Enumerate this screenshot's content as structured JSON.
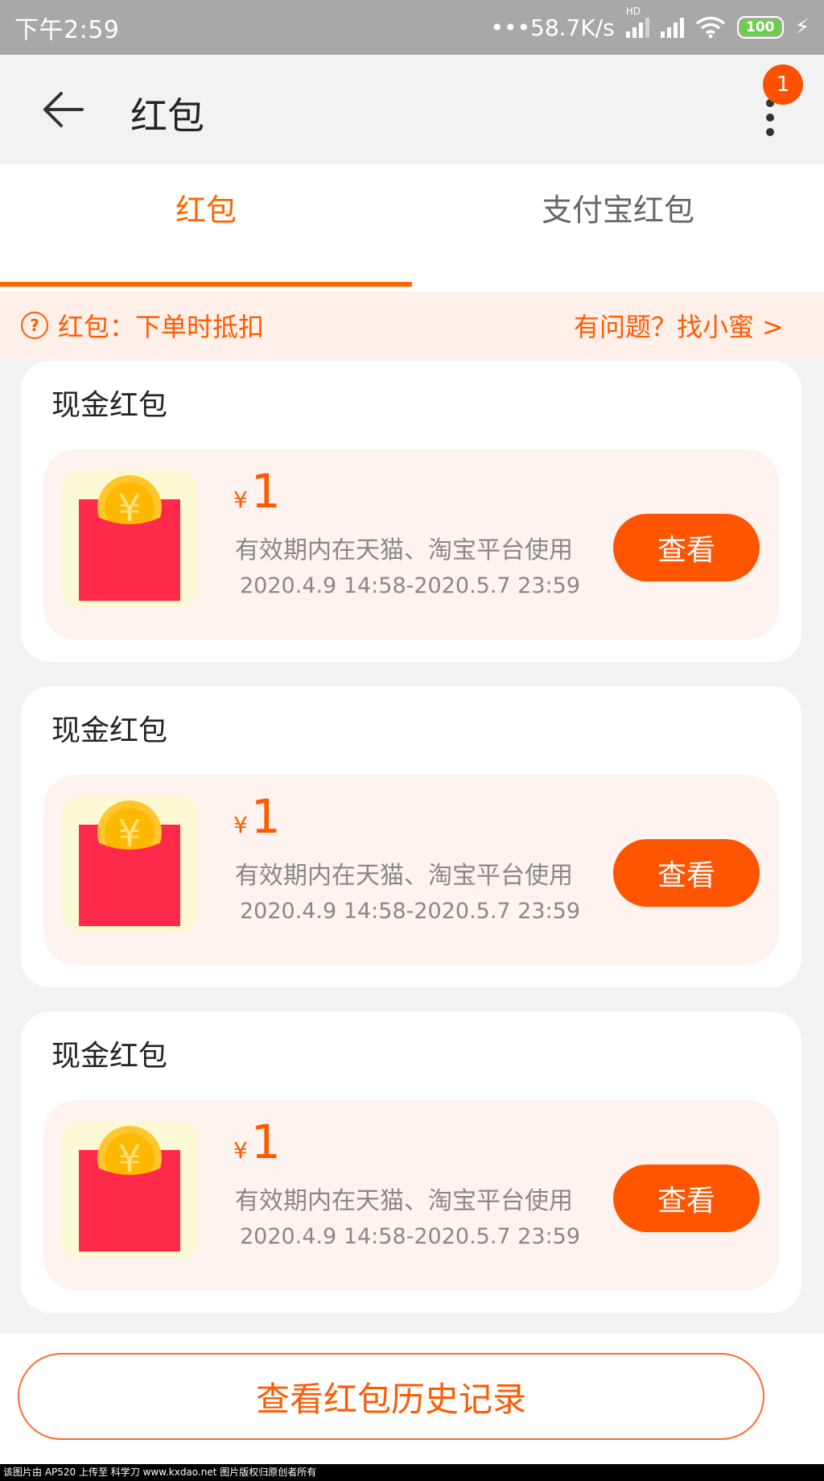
{
  "status_bar": {
    "time": "下午2:59",
    "network_speed": "•••58.7K/s",
    "battery": "100",
    "hd_label": "HD"
  },
  "header": {
    "title": "红包",
    "badge_count": "1"
  },
  "tabs": [
    {
      "label": "红包",
      "active": true
    },
    {
      "label": "支付宝红包",
      "active": false
    }
  ],
  "notice": {
    "left_text": "红包：下单时抵扣",
    "right_text": "有问题？找小蜜 >"
  },
  "cards": [
    {
      "title": "现金红包",
      "currency": "¥",
      "amount": "1",
      "description": "有效期内在天猫、淘宝平台使用",
      "validity": "2020.4.9 14:58-2020.5.7 23:59",
      "button": "查看"
    },
    {
      "title": "现金红包",
      "currency": "¥",
      "amount": "1",
      "description": "有效期内在天猫、淘宝平台使用",
      "validity": "2020.4.9 14:58-2020.5.7 23:59",
      "button": "查看"
    },
    {
      "title": "现金红包",
      "currency": "¥",
      "amount": "1",
      "description": "有效期内在天猫、淘宝平台使用",
      "validity": "2020.4.9 14:58-2020.5.7 23:59",
      "button": "查看"
    }
  ],
  "bottom": {
    "history_button": "查看红包历史记录"
  },
  "watermark": "该图片由 AP520 上传至 科学刀 www.kxdao.net 图片版权归原创者所有",
  "colors": {
    "accent": "#ff5500",
    "envelope": "#ff2a4a",
    "coin": "#ffc62e",
    "notice_bg": "#fff0ea"
  }
}
